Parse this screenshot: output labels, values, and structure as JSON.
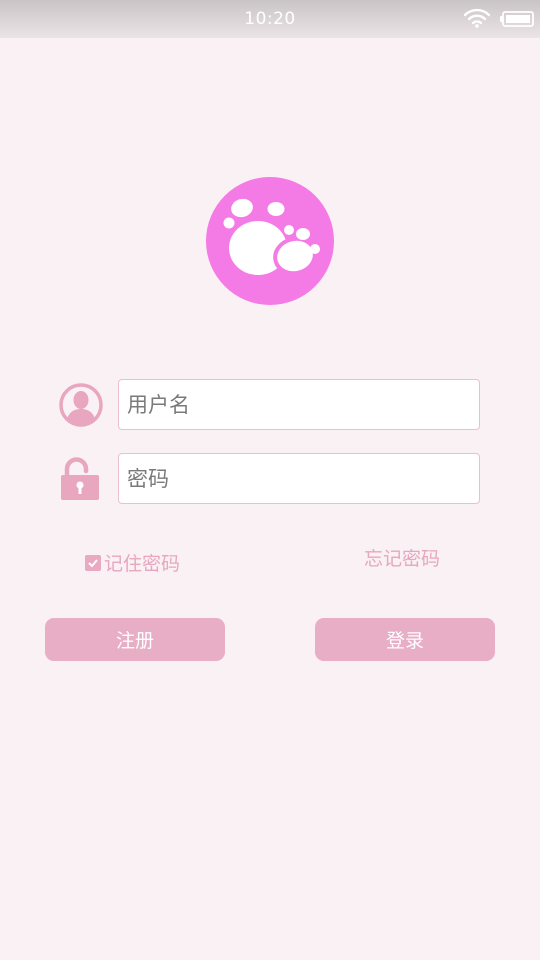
{
  "status_bar": {
    "time": "10:20",
    "icons": [
      "wifi-icon",
      "battery-icon"
    ]
  },
  "logo": {
    "icon": "paw-print-icon",
    "color": "#f47ae6"
  },
  "form": {
    "username": {
      "icon": "user-avatar-icon",
      "placeholder": "用户名",
      "value": ""
    },
    "password": {
      "icon": "unlocked-padlock-icon",
      "placeholder": "密码",
      "value": ""
    },
    "remember_password": {
      "label": "记住密码",
      "checked": true
    },
    "forgot_password_label": "忘记密码"
  },
  "actions": {
    "register_label": "注册",
    "login_label": "登录"
  },
  "colors": {
    "background": "#f9f1f4",
    "accent_pink": "#e8aec5",
    "text_pink": "#e8a6bf",
    "logo_magenta": "#f47ae6"
  }
}
